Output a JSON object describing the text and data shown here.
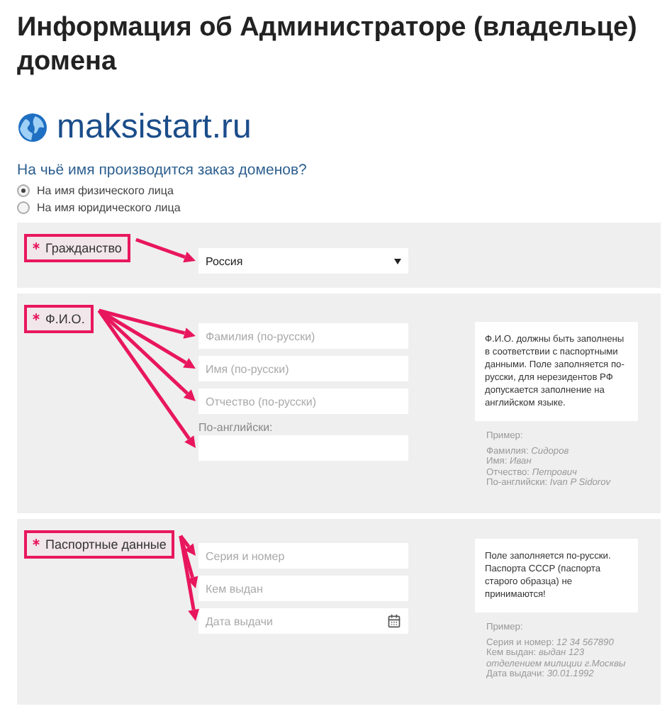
{
  "title": "Информация об Администраторе (владельце) домена",
  "logo": {
    "text": "maksistart.ru"
  },
  "question": "На чьё имя производится заказ доменов?",
  "options": [
    {
      "label": "На имя физического лица",
      "selected": true
    },
    {
      "label": "На имя юридического лица",
      "selected": false
    }
  ],
  "sections": [
    {
      "label": "Гражданство",
      "required": true,
      "highlighted": true,
      "fields": [
        {
          "kind": "select",
          "value": "Россия"
        }
      ]
    },
    {
      "label": "Ф.И.О.",
      "required": true,
      "highlighted": true,
      "fields": [
        {
          "kind": "text",
          "placeholder": "Фамилия (по-русски)"
        },
        {
          "kind": "text",
          "placeholder": "Имя (по-русски)"
        },
        {
          "kind": "text",
          "placeholder": "Отчество (по-русски)"
        },
        {
          "kind": "captioned",
          "caption": "По-английски:"
        }
      ],
      "note": "Ф.И.О. должны быть заполнены в соответствии с паспортными данными. Поле заполняется по-русски, для нерезидентов РФ допускается заполнение на английском языке.",
      "example": {
        "heading": "Пример:",
        "lines": [
          "Фамилия: *Сидоров*",
          "Имя: *Иван*",
          "Отчество: *Петрович*",
          "По-английски: *Ivan P Sidorov*"
        ]
      }
    },
    {
      "label": "Паспортные данные",
      "required": true,
      "highlighted": true,
      "fields": [
        {
          "kind": "text",
          "placeholder": "Серия и номер"
        },
        {
          "kind": "text",
          "placeholder": "Кем выдан"
        },
        {
          "kind": "date",
          "placeholder": "Дата выдачи"
        }
      ],
      "note": "Поле заполняется по-русски. Паспорта СССР (паспорта старого образца) не принимаются!",
      "example": {
        "heading": "Пример:",
        "lines": [
          "Серия и номер: *12 34 567890*",
          "Кем выдан: *выдан 123 отделением милиции г.Москвы*",
          "Дата выдачи: *30.01.1992*"
        ]
      }
    }
  ]
}
